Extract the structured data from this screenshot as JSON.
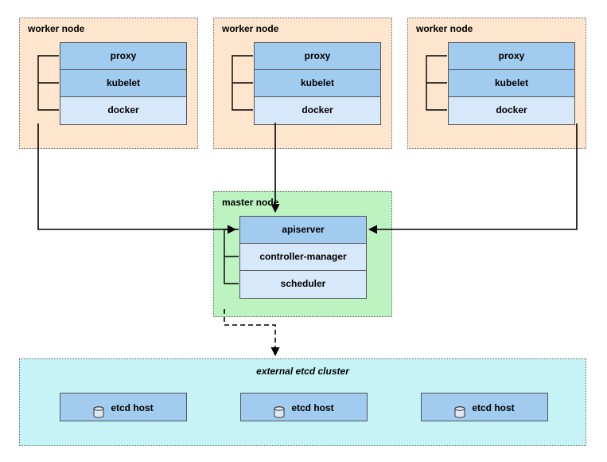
{
  "workers": [
    {
      "title": "worker node",
      "cells": [
        "proxy",
        "kubelet",
        "docker"
      ]
    },
    {
      "title": "worker node",
      "cells": [
        "proxy",
        "kubelet",
        "docker"
      ]
    },
    {
      "title": "worker node",
      "cells": [
        "proxy",
        "kubelet",
        "docker"
      ]
    }
  ],
  "master": {
    "title": "master node",
    "cells": [
      "apiserver",
      "controller-manager",
      "scheduler"
    ]
  },
  "etcd": {
    "title": "external etcd cluster",
    "hosts": [
      "etcd host",
      "etcd host",
      "etcd host"
    ]
  },
  "colors": {
    "worker_bg": "#FDE5CE",
    "master_bg": "#BDF2C1",
    "etcd_bg": "#C6F4F6",
    "cell_blue": "#A1CBEF",
    "cell_light": "#D6E8F9"
  }
}
